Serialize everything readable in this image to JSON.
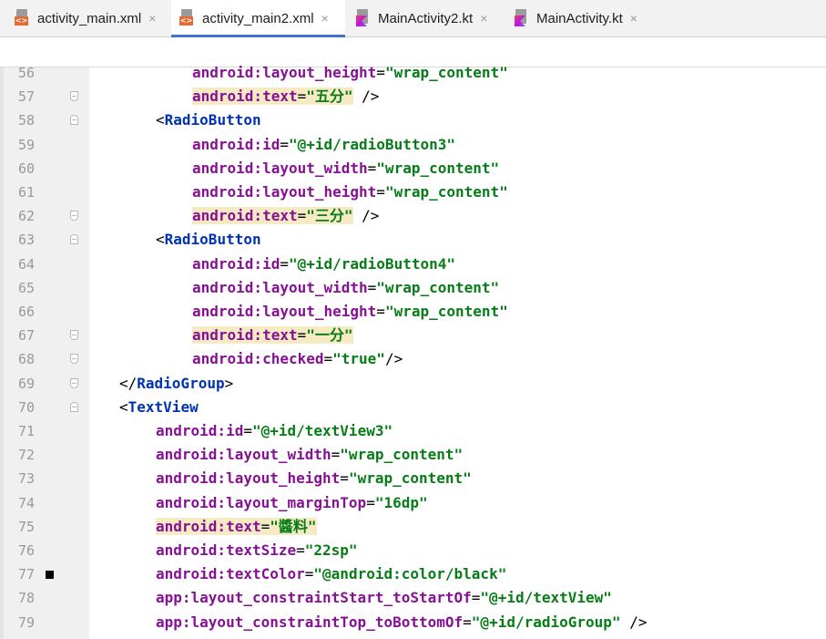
{
  "tabs": [
    {
      "label": "activity_main.xml",
      "icon": "xml-file-icon",
      "active": false
    },
    {
      "label": "activity_main2.xml",
      "icon": "xml-file-icon",
      "active": true
    },
    {
      "label": "MainActivity2.kt",
      "icon": "kotlin-file-icon",
      "active": false
    },
    {
      "label": "MainActivity.kt",
      "icon": "kotlin-file-icon",
      "active": false
    }
  ],
  "close_glyph": "×",
  "colors": {
    "attribute": "#871094",
    "value": "#067d17",
    "tag": "#0033b3",
    "highlight": "#f5eac3",
    "active_tab_underline": "#3f74c6"
  },
  "lines": [
    {
      "num": "56",
      "parts": [
        {
          "t": "android:layout_height",
          "c": "attr"
        },
        {
          "t": "=",
          "c": "eq"
        },
        {
          "t": "\"wrap_content\"",
          "c": "val"
        }
      ]
    },
    {
      "num": "57",
      "parts": [
        {
          "t": "android:text",
          "c": "attr hl"
        },
        {
          "t": "=",
          "c": "eq hl"
        },
        {
          "t": "\"五分\"",
          "c": "val hl"
        },
        {
          "t": " />",
          "c": "punct"
        }
      ]
    },
    {
      "num": "58",
      "parts": [
        {
          "t": "<",
          "c": "punct"
        },
        {
          "t": "RadioButton",
          "c": "tag"
        }
      ]
    },
    {
      "num": "59",
      "parts": [
        {
          "t": "android:id",
          "c": "attr"
        },
        {
          "t": "=",
          "c": "eq"
        },
        {
          "t": "\"@+id/radioButton3\"",
          "c": "val"
        }
      ]
    },
    {
      "num": "60",
      "parts": [
        {
          "t": "android:layout_width",
          "c": "attr"
        },
        {
          "t": "=",
          "c": "eq"
        },
        {
          "t": "\"wrap_content\"",
          "c": "val"
        }
      ]
    },
    {
      "num": "61",
      "parts": [
        {
          "t": "android:layout_height",
          "c": "attr"
        },
        {
          "t": "=",
          "c": "eq"
        },
        {
          "t": "\"wrap_content\"",
          "c": "val"
        }
      ]
    },
    {
      "num": "62",
      "parts": [
        {
          "t": "android:text",
          "c": "attr hl"
        },
        {
          "t": "=",
          "c": "eq hl"
        },
        {
          "t": "\"三分\"",
          "c": "val hl"
        },
        {
          "t": " />",
          "c": "punct"
        }
      ]
    },
    {
      "num": "63",
      "parts": [
        {
          "t": "<",
          "c": "punct"
        },
        {
          "t": "RadioButton",
          "c": "tag"
        }
      ]
    },
    {
      "num": "64",
      "parts": [
        {
          "t": "android:id",
          "c": "attr"
        },
        {
          "t": "=",
          "c": "eq"
        },
        {
          "t": "\"@+id/radioButton4\"",
          "c": "val"
        }
      ]
    },
    {
      "num": "65",
      "parts": [
        {
          "t": "android:layout_width",
          "c": "attr"
        },
        {
          "t": "=",
          "c": "eq"
        },
        {
          "t": "\"wrap_content\"",
          "c": "val"
        }
      ]
    },
    {
      "num": "66",
      "parts": [
        {
          "t": "android:layout_height",
          "c": "attr"
        },
        {
          "t": "=",
          "c": "eq"
        },
        {
          "t": "\"wrap_content\"",
          "c": "val"
        }
      ]
    },
    {
      "num": "67",
      "parts": [
        {
          "t": "android:text",
          "c": "attr hl"
        },
        {
          "t": "=",
          "c": "eq hl"
        },
        {
          "t": "\"一分\"",
          "c": "val hl"
        }
      ]
    },
    {
      "num": "68",
      "parts": [
        {
          "t": "android:checked",
          "c": "attr"
        },
        {
          "t": "=",
          "c": "eq"
        },
        {
          "t": "\"true\"",
          "c": "val"
        },
        {
          "t": "/>",
          "c": "punct"
        }
      ]
    },
    {
      "num": "69",
      "parts": [
        {
          "t": "</",
          "c": "punct"
        },
        {
          "t": "RadioGroup",
          "c": "tag"
        },
        {
          "t": ">",
          "c": "punct"
        }
      ]
    },
    {
      "num": "70",
      "parts": [
        {
          "t": "<",
          "c": "punct"
        },
        {
          "t": "TextView",
          "c": "tag"
        }
      ]
    },
    {
      "num": "71",
      "parts": [
        {
          "t": "android:id",
          "c": "attr"
        },
        {
          "t": "=",
          "c": "eq"
        },
        {
          "t": "\"@+id/textView3\"",
          "c": "val"
        }
      ]
    },
    {
      "num": "72",
      "parts": [
        {
          "t": "android:layout_width",
          "c": "attr"
        },
        {
          "t": "=",
          "c": "eq"
        },
        {
          "t": "\"wrap_content\"",
          "c": "val"
        }
      ]
    },
    {
      "num": "73",
      "parts": [
        {
          "t": "android:layout_height",
          "c": "attr"
        },
        {
          "t": "=",
          "c": "eq"
        },
        {
          "t": "\"wrap_content\"",
          "c": "val"
        }
      ]
    },
    {
      "num": "74",
      "parts": [
        {
          "t": "android:layout_marginTop",
          "c": "attr"
        },
        {
          "t": "=",
          "c": "eq"
        },
        {
          "t": "\"16dp\"",
          "c": "val"
        }
      ]
    },
    {
      "num": "75",
      "parts": [
        {
          "t": "android:text",
          "c": "attr hl"
        },
        {
          "t": "=",
          "c": "eq hl"
        },
        {
          "t": "\"醬料\"",
          "c": "val hl"
        }
      ]
    },
    {
      "num": "76",
      "parts": [
        {
          "t": "android:textSize",
          "c": "attr"
        },
        {
          "t": "=",
          "c": "eq"
        },
        {
          "t": "\"22sp\"",
          "c": "val"
        }
      ]
    },
    {
      "num": "77",
      "parts": [
        {
          "t": "android:textColor",
          "c": "attr"
        },
        {
          "t": "=",
          "c": "eq"
        },
        {
          "t": "\"@android:color/black\"",
          "c": "val"
        }
      ]
    },
    {
      "num": "78",
      "parts": [
        {
          "t": "app:layout_constraintStart_toStartOf",
          "c": "attr"
        },
        {
          "t": "=",
          "c": "eq"
        },
        {
          "t": "\"@+id/textView\"",
          "c": "val"
        }
      ]
    },
    {
      "num": "79",
      "parts": [
        {
          "t": "app:layout_constraintTop_toBottomOf",
          "c": "attr"
        },
        {
          "t": "=",
          "c": "eq"
        },
        {
          "t": "\"@+id/radioGroup\"",
          "c": "val"
        },
        {
          "t": " />",
          "c": "punct"
        }
      ]
    }
  ]
}
